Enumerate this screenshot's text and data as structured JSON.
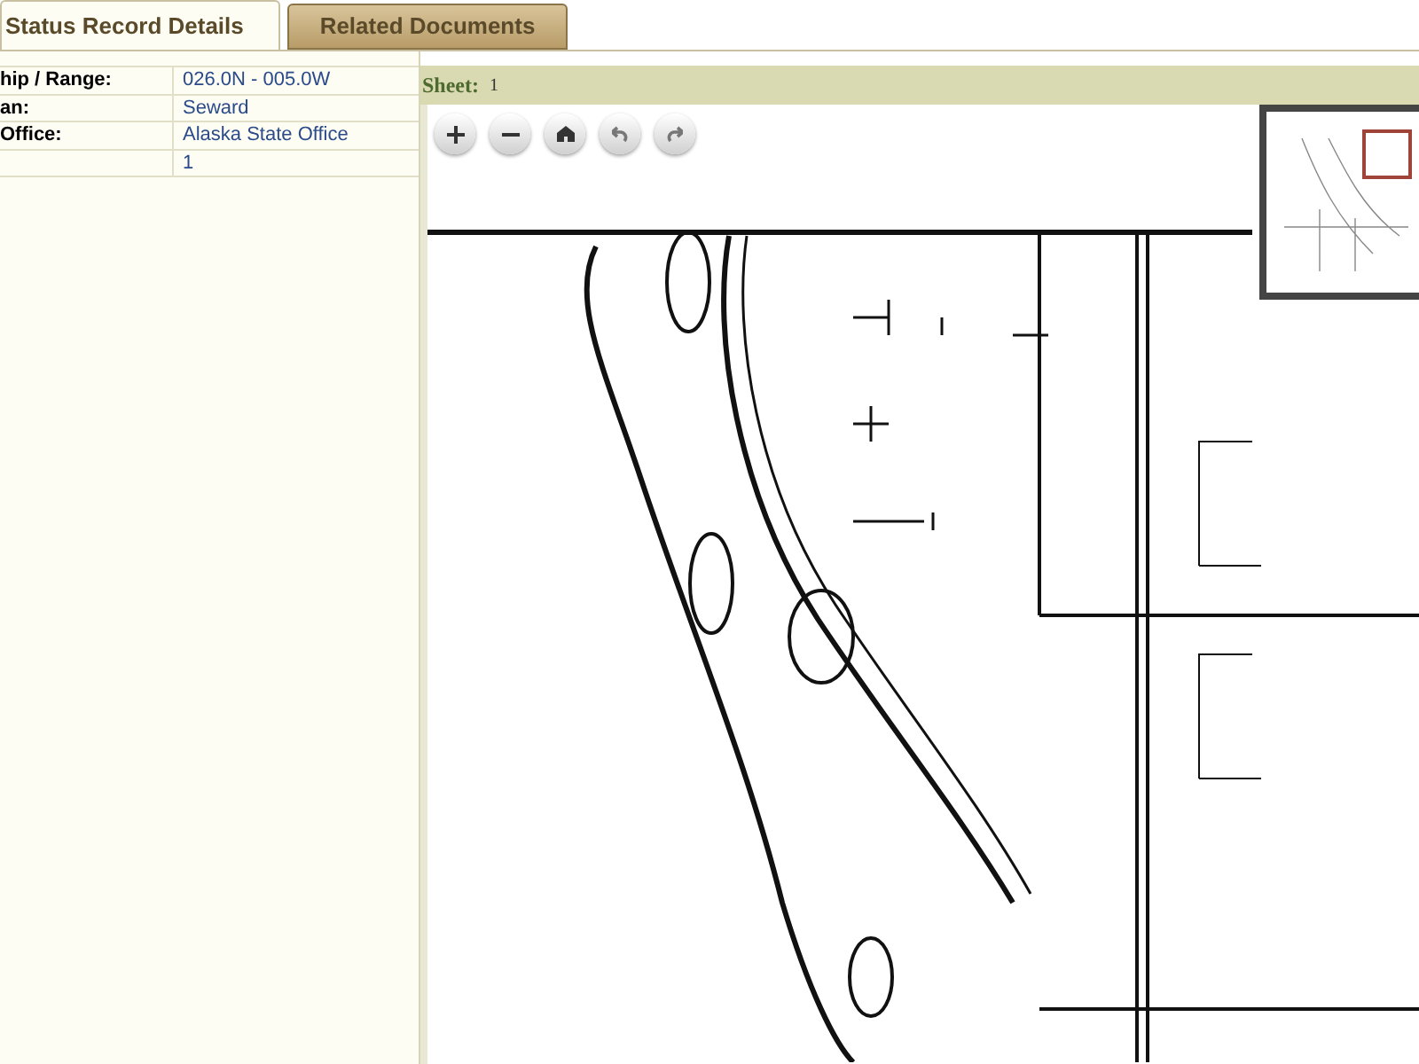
{
  "tabs": [
    {
      "label": "Status Record Details",
      "selected": true
    },
    {
      "label": "Related Documents",
      "selected": false
    }
  ],
  "details": [
    {
      "label": "hip / Range:",
      "value": "026.0N - 005.0W"
    },
    {
      "label": "an:",
      "value": "Seward"
    },
    {
      "label": "Office:",
      "value": "Alaska State Office"
    },
    {
      "value": "1"
    }
  ],
  "viewer": {
    "sheet_label": "Sheet:",
    "sheet_value": "1",
    "tools": [
      {
        "kind": "zoom-in"
      },
      {
        "kind": "zoom-out"
      },
      {
        "kind": "home"
      },
      {
        "kind": "rotate-left"
      },
      {
        "kind": "rotate-right"
      }
    ]
  }
}
